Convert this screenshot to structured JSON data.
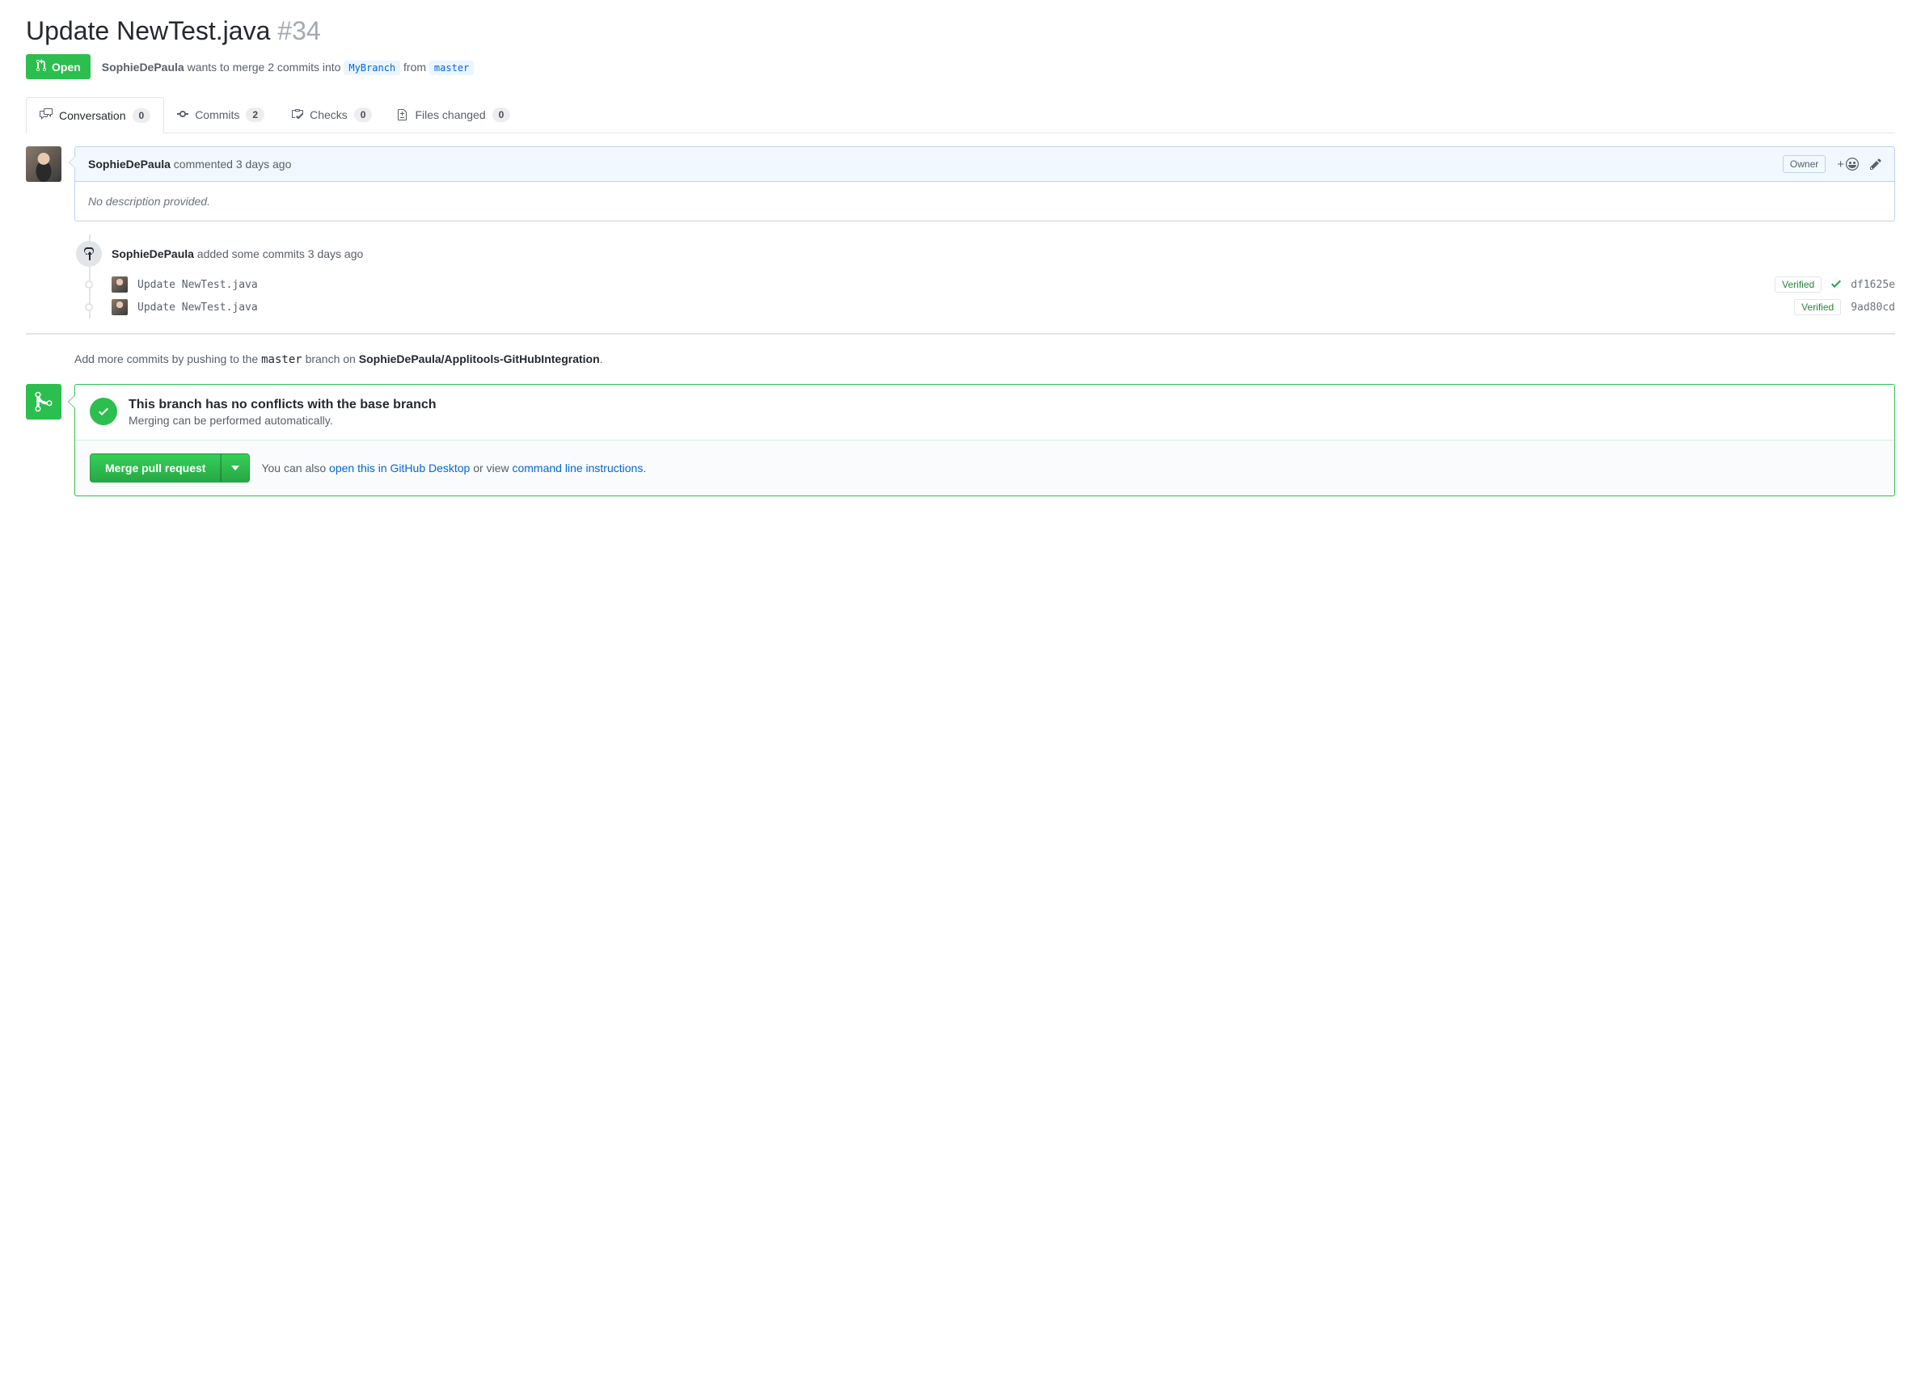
{
  "pr": {
    "title": "Update NewTest.java",
    "number": "#34",
    "status": "Open",
    "author": "SophieDePaula",
    "wants_text_1": " wants to merge 2 commits into ",
    "base_branch": "MyBranch",
    "wants_text_2": " from ",
    "head_branch": "master"
  },
  "tabs": {
    "conversation": {
      "label": "Conversation",
      "count": "0"
    },
    "commits": {
      "label": "Commits",
      "count": "2"
    },
    "checks": {
      "label": "Checks",
      "count": "0"
    },
    "files": {
      "label": "Files changed",
      "count": "0"
    }
  },
  "comment": {
    "author": "SophieDePaula",
    "action": " commented ",
    "time": "3 days ago",
    "owner_label": "Owner",
    "body": "No description provided."
  },
  "commits_event": {
    "author": "SophieDePaula",
    "text": " added some commits ",
    "time": "3 days ago"
  },
  "commits": [
    {
      "msg": "Update NewTest.java",
      "verified": "Verified",
      "sha": "df1625e",
      "has_check": true
    },
    {
      "msg": "Update NewTest.java",
      "verified": "Verified",
      "sha": "9ad80cd",
      "has_check": false
    }
  ],
  "push_hint": {
    "prefix": "Add more commits by pushing to the ",
    "branch": "master",
    "mid": " branch on ",
    "repo": "SophieDePaula/Applitools-GitHubIntegration",
    "suffix": "."
  },
  "merge": {
    "title": "This branch has no conflicts with the base branch",
    "subtitle": "Merging can be performed automatically.",
    "button": "Merge pull request",
    "alt_prefix": "You can also ",
    "alt_link1": "open this in GitHub Desktop",
    "alt_mid": " or view ",
    "alt_link2": "command line instructions",
    "alt_suffix": "."
  }
}
